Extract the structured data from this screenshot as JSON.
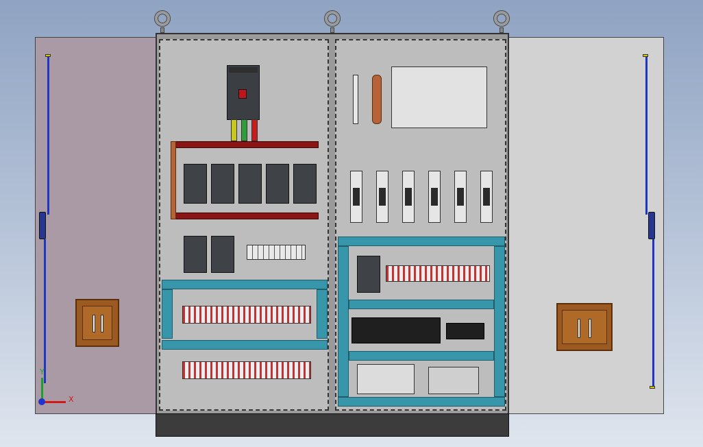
{
  "axis_triad": {
    "x_label": "X",
    "y_label": "Y"
  },
  "colors": {
    "background_top": "#8fa3c2",
    "door_left": "#a99aa6",
    "door_right": "#d2d2d2",
    "cabinet_panel": "#bdbdbd",
    "busbar": "#8a1515",
    "wire_duct": "#3796a9",
    "door_rod": "#1f35c4",
    "handle": "#9a5a22"
  }
}
